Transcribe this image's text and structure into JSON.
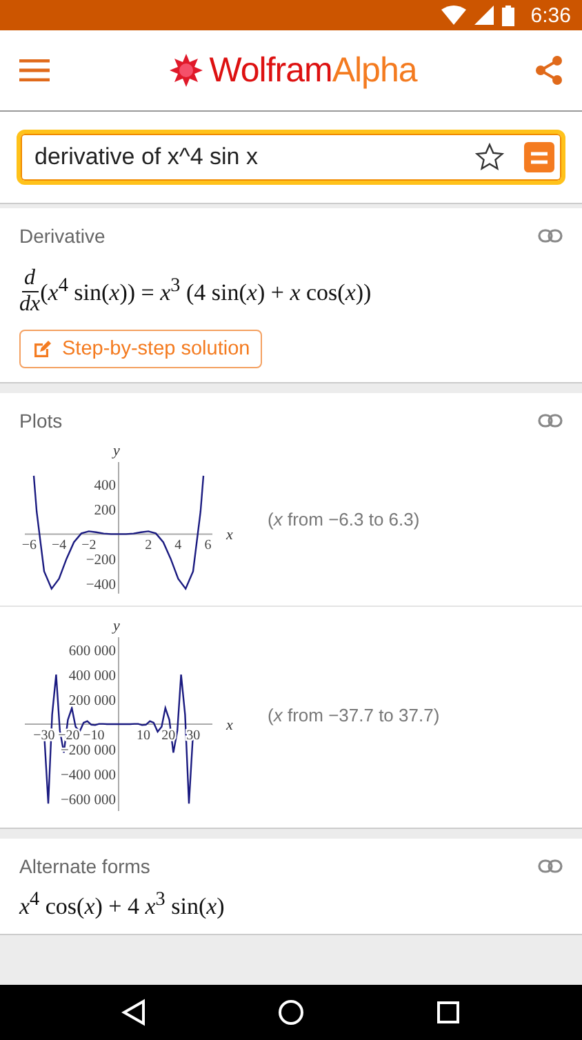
{
  "status_bar": {
    "time": "6:36"
  },
  "header": {
    "logo": {
      "word_1": "Wolfram",
      "word_2": "Alpha"
    }
  },
  "search": {
    "value": "derivative of x^4 sin x",
    "favorite": false
  },
  "pods": [
    {
      "kind": "formula",
      "title": "Derivative",
      "numerator": "d",
      "denominator": "dx",
      "expression": "(*x*$^{4}$ sin(*x*)) = *x*$^{3}$ (4 sin(*x*) + *x* cos(*x*))",
      "button": "Step-by-step solution"
    },
    {
      "kind": "plots",
      "title": "Plots",
      "plots": [
        {
          "caption": "(*x* from −6.3 to 6.3)",
          "chart_data": {
            "type": "line",
            "xlabel": "x",
            "ylabel": "y",
            "x": [
              -5.7,
              -5.5,
              -5,
              -4.5,
              -4,
              -3.5,
              -3,
              -2.5,
              -2,
              -1.5,
              -1,
              -0.5,
              0,
              0.5,
              1,
              1.5,
              2,
              2.5,
              3,
              3.5,
              4,
              4.5,
              5,
              5.5,
              5.7
            ],
            "series": [
              {
                "color": "#1a1a80",
                "values": [
                  470,
                  180,
                  -300,
                  -440,
                  -360,
                  -200,
                  -65,
                  6,
                  22,
                  14,
                  4,
                  0,
                  0,
                  0,
                  4,
                  14,
                  22,
                  6,
                  -65,
                  -200,
                  -360,
                  -440,
                  -300,
                  180,
                  470
                ]
              }
            ],
            "xlim": [
              -6.3,
              6.3
            ],
            "ylim": [
              -480,
              580
            ],
            "xticks": [
              {
                "value": -6,
                "label": "−6"
              },
              {
                "value": -4,
                "label": "−4"
              },
              {
                "value": -2,
                "label": "−2"
              },
              {
                "value": 2,
                "label": "2"
              },
              {
                "value": 4,
                "label": "4"
              },
              {
                "value": 6,
                "label": "6"
              }
            ],
            "yticks": [
              {
                "value": -400,
                "label": "−400"
              },
              {
                "value": -200,
                "label": "−200"
              },
              {
                "value": 200,
                "label": "200"
              },
              {
                "value": 400,
                "label": "400"
              }
            ]
          }
        },
        {
          "caption": "(*x* from −37.7 to 37.7)",
          "chart_data": {
            "type": "line",
            "xlabel": "x",
            "ylabel": "y",
            "x": [
              -29.8,
              -28.3,
              -26.7,
              -25.1,
              -23.6,
              -22.0,
              -20.4,
              -18.8,
              -17.3,
              -15.7,
              -14.1,
              -12.6,
              -11.0,
              -9.4,
              -7.9,
              -6.3,
              -4.7,
              -3.1,
              -1.6,
              0,
              1.6,
              3.1,
              4.7,
              6.3,
              7.9,
              9.4,
              11.0,
              12.6,
              14.1,
              15.7,
              17.3,
              18.8,
              20.4,
              22.0,
              23.6,
              25.1,
              26.7,
              28.3,
              29.8
            ],
            "series": [
              {
                "color": "#1a1a80",
                "values": [
                  -110000,
                  -640000,
                  76000,
                  400000,
                  -52000,
                  -230000,
                  34000,
                  130000,
                  -21000,
                  -61000,
                  11000,
                  25000,
                  -5000,
                  -8000,
                  2000,
                  2000,
                  0,
                  0,
                  0,
                  0,
                  0,
                  0,
                  0,
                  2000,
                  2000,
                  -8000,
                  -5000,
                  25000,
                  11000,
                  -61000,
                  -21000,
                  130000,
                  34000,
                  -230000,
                  -52000,
                  400000,
                  76000,
                  -640000,
                  -110000
                ]
              }
            ],
            "xlim": [
              -37.7,
              37.7
            ],
            "ylim": [
              -700000,
              700000
            ],
            "xticks": [
              {
                "value": -30,
                "label": "−30"
              },
              {
                "value": -20,
                "label": "−20"
              },
              {
                "value": -10,
                "label": "−10"
              },
              {
                "value": 10,
                "label": "10"
              },
              {
                "value": 20,
                "label": "20"
              },
              {
                "value": 30,
                "label": "30"
              }
            ],
            "yticks": [
              {
                "value": -600000,
                "label": "−600 000"
              },
              {
                "value": -400000,
                "label": "−400 000"
              },
              {
                "value": -200000,
                "label": "−200 000"
              },
              {
                "value": 200000,
                "label": "200 000"
              },
              {
                "value": 400000,
                "label": "400 000"
              },
              {
                "value": 600000,
                "label": "600 000"
              }
            ]
          }
        }
      ]
    },
    {
      "kind": "formula",
      "title": "Alternate forms",
      "expression": "*x*$^{4}$ cos(*x*) + 4 *x*$^{3}$ sin(*x*)"
    }
  ]
}
